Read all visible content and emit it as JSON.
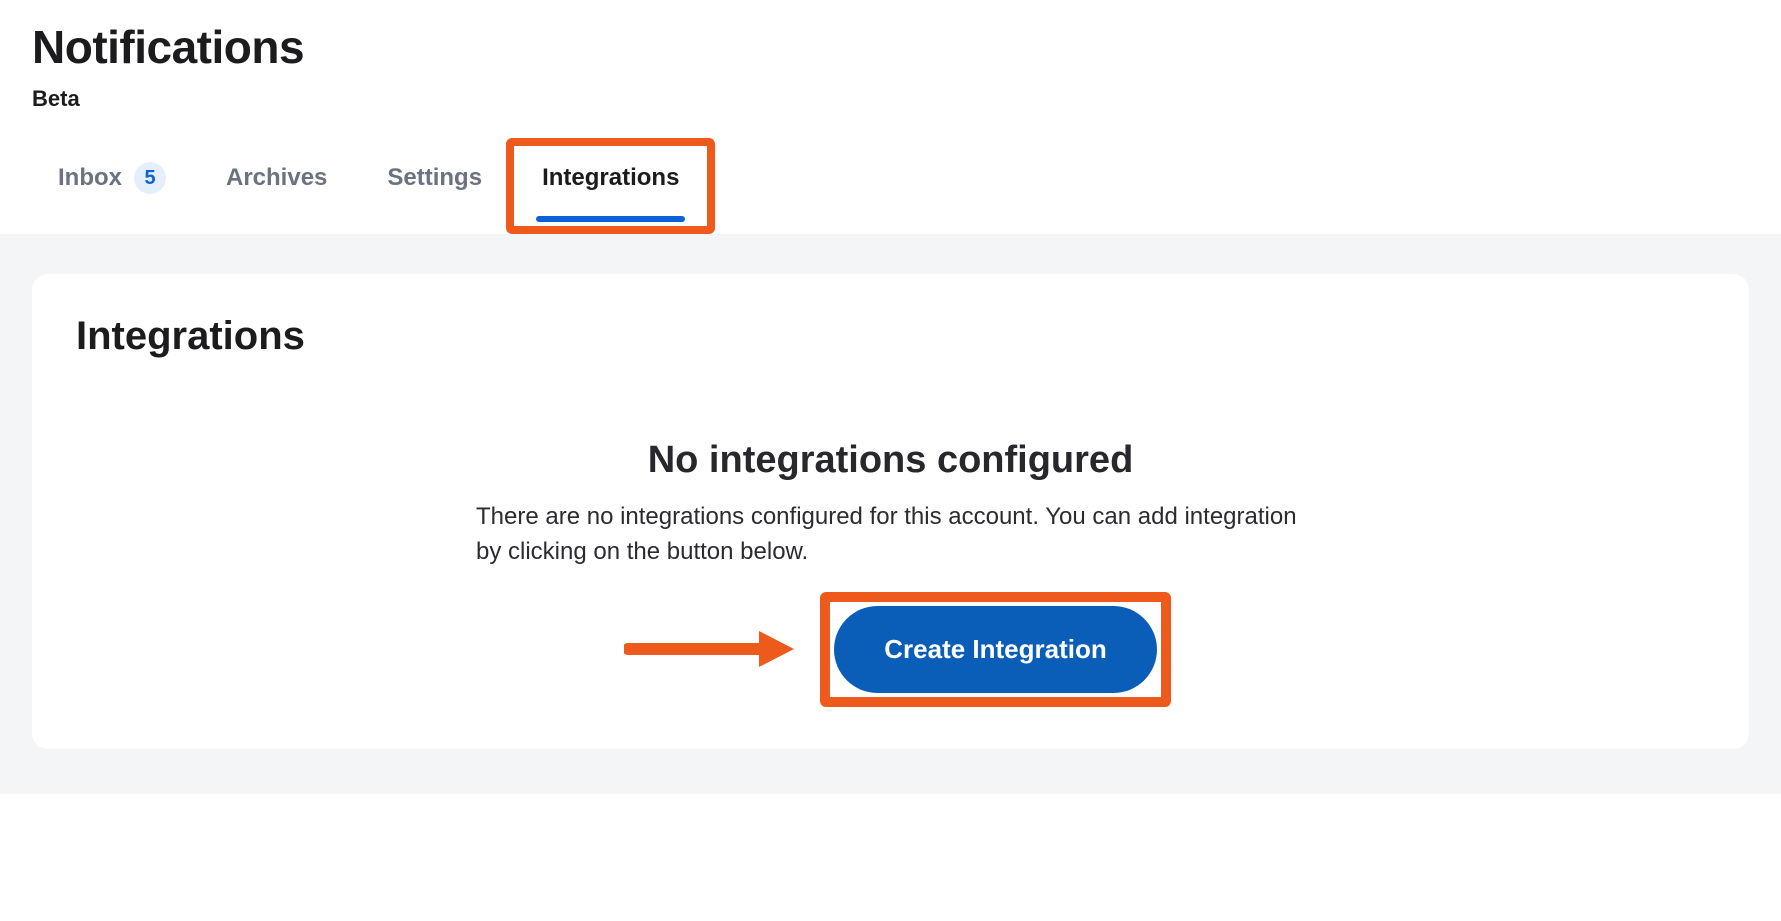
{
  "header": {
    "title": "Notifications",
    "subtitle": "Beta"
  },
  "tabs": {
    "inbox": {
      "label": "Inbox",
      "count": "5"
    },
    "archives": {
      "label": "Archives"
    },
    "settings": {
      "label": "Settings"
    },
    "integrations": {
      "label": "Integrations"
    }
  },
  "panel": {
    "title": "Integrations",
    "empty_title": "No integrations configured",
    "empty_desc": "There are no integrations configured for this account. You can add integration by clicking on the button below.",
    "cta_label": "Create Integration"
  },
  "highlight_color": "#ee5a1b",
  "accent_color": "#0b5eb8"
}
